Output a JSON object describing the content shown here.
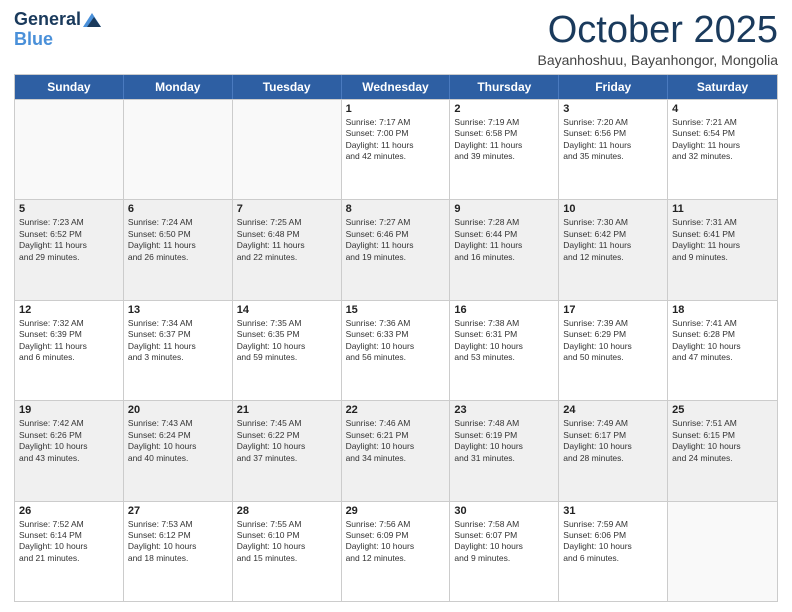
{
  "header": {
    "logo_general": "General",
    "logo_blue": "Blue",
    "month_title": "October 2025",
    "location": "Bayanhoshuu, Bayanhongor, Mongolia"
  },
  "days_of_week": [
    "Sunday",
    "Monday",
    "Tuesday",
    "Wednesday",
    "Thursday",
    "Friday",
    "Saturday"
  ],
  "rows": [
    [
      {
        "day": "",
        "lines": []
      },
      {
        "day": "",
        "lines": []
      },
      {
        "day": "",
        "lines": []
      },
      {
        "day": "1",
        "lines": [
          "Sunrise: 7:17 AM",
          "Sunset: 7:00 PM",
          "Daylight: 11 hours",
          "and 42 minutes."
        ]
      },
      {
        "day": "2",
        "lines": [
          "Sunrise: 7:19 AM",
          "Sunset: 6:58 PM",
          "Daylight: 11 hours",
          "and 39 minutes."
        ]
      },
      {
        "day": "3",
        "lines": [
          "Sunrise: 7:20 AM",
          "Sunset: 6:56 PM",
          "Daylight: 11 hours",
          "and 35 minutes."
        ]
      },
      {
        "day": "4",
        "lines": [
          "Sunrise: 7:21 AM",
          "Sunset: 6:54 PM",
          "Daylight: 11 hours",
          "and 32 minutes."
        ]
      }
    ],
    [
      {
        "day": "5",
        "lines": [
          "Sunrise: 7:23 AM",
          "Sunset: 6:52 PM",
          "Daylight: 11 hours",
          "and 29 minutes."
        ]
      },
      {
        "day": "6",
        "lines": [
          "Sunrise: 7:24 AM",
          "Sunset: 6:50 PM",
          "Daylight: 11 hours",
          "and 26 minutes."
        ]
      },
      {
        "day": "7",
        "lines": [
          "Sunrise: 7:25 AM",
          "Sunset: 6:48 PM",
          "Daylight: 11 hours",
          "and 22 minutes."
        ]
      },
      {
        "day": "8",
        "lines": [
          "Sunrise: 7:27 AM",
          "Sunset: 6:46 PM",
          "Daylight: 11 hours",
          "and 19 minutes."
        ]
      },
      {
        "day": "9",
        "lines": [
          "Sunrise: 7:28 AM",
          "Sunset: 6:44 PM",
          "Daylight: 11 hours",
          "and 16 minutes."
        ]
      },
      {
        "day": "10",
        "lines": [
          "Sunrise: 7:30 AM",
          "Sunset: 6:42 PM",
          "Daylight: 11 hours",
          "and 12 minutes."
        ]
      },
      {
        "day": "11",
        "lines": [
          "Sunrise: 7:31 AM",
          "Sunset: 6:41 PM",
          "Daylight: 11 hours",
          "and 9 minutes."
        ]
      }
    ],
    [
      {
        "day": "12",
        "lines": [
          "Sunrise: 7:32 AM",
          "Sunset: 6:39 PM",
          "Daylight: 11 hours",
          "and 6 minutes."
        ]
      },
      {
        "day": "13",
        "lines": [
          "Sunrise: 7:34 AM",
          "Sunset: 6:37 PM",
          "Daylight: 11 hours",
          "and 3 minutes."
        ]
      },
      {
        "day": "14",
        "lines": [
          "Sunrise: 7:35 AM",
          "Sunset: 6:35 PM",
          "Daylight: 10 hours",
          "and 59 minutes."
        ]
      },
      {
        "day": "15",
        "lines": [
          "Sunrise: 7:36 AM",
          "Sunset: 6:33 PM",
          "Daylight: 10 hours",
          "and 56 minutes."
        ]
      },
      {
        "day": "16",
        "lines": [
          "Sunrise: 7:38 AM",
          "Sunset: 6:31 PM",
          "Daylight: 10 hours",
          "and 53 minutes."
        ]
      },
      {
        "day": "17",
        "lines": [
          "Sunrise: 7:39 AM",
          "Sunset: 6:29 PM",
          "Daylight: 10 hours",
          "and 50 minutes."
        ]
      },
      {
        "day": "18",
        "lines": [
          "Sunrise: 7:41 AM",
          "Sunset: 6:28 PM",
          "Daylight: 10 hours",
          "and 47 minutes."
        ]
      }
    ],
    [
      {
        "day": "19",
        "lines": [
          "Sunrise: 7:42 AM",
          "Sunset: 6:26 PM",
          "Daylight: 10 hours",
          "and 43 minutes."
        ]
      },
      {
        "day": "20",
        "lines": [
          "Sunrise: 7:43 AM",
          "Sunset: 6:24 PM",
          "Daylight: 10 hours",
          "and 40 minutes."
        ]
      },
      {
        "day": "21",
        "lines": [
          "Sunrise: 7:45 AM",
          "Sunset: 6:22 PM",
          "Daylight: 10 hours",
          "and 37 minutes."
        ]
      },
      {
        "day": "22",
        "lines": [
          "Sunrise: 7:46 AM",
          "Sunset: 6:21 PM",
          "Daylight: 10 hours",
          "and 34 minutes."
        ]
      },
      {
        "day": "23",
        "lines": [
          "Sunrise: 7:48 AM",
          "Sunset: 6:19 PM",
          "Daylight: 10 hours",
          "and 31 minutes."
        ]
      },
      {
        "day": "24",
        "lines": [
          "Sunrise: 7:49 AM",
          "Sunset: 6:17 PM",
          "Daylight: 10 hours",
          "and 28 minutes."
        ]
      },
      {
        "day": "25",
        "lines": [
          "Sunrise: 7:51 AM",
          "Sunset: 6:15 PM",
          "Daylight: 10 hours",
          "and 24 minutes."
        ]
      }
    ],
    [
      {
        "day": "26",
        "lines": [
          "Sunrise: 7:52 AM",
          "Sunset: 6:14 PM",
          "Daylight: 10 hours",
          "and 21 minutes."
        ]
      },
      {
        "day": "27",
        "lines": [
          "Sunrise: 7:53 AM",
          "Sunset: 6:12 PM",
          "Daylight: 10 hours",
          "and 18 minutes."
        ]
      },
      {
        "day": "28",
        "lines": [
          "Sunrise: 7:55 AM",
          "Sunset: 6:10 PM",
          "Daylight: 10 hours",
          "and 15 minutes."
        ]
      },
      {
        "day": "29",
        "lines": [
          "Sunrise: 7:56 AM",
          "Sunset: 6:09 PM",
          "Daylight: 10 hours",
          "and 12 minutes."
        ]
      },
      {
        "day": "30",
        "lines": [
          "Sunrise: 7:58 AM",
          "Sunset: 6:07 PM",
          "Daylight: 10 hours",
          "and 9 minutes."
        ]
      },
      {
        "day": "31",
        "lines": [
          "Sunrise: 7:59 AM",
          "Sunset: 6:06 PM",
          "Daylight: 10 hours",
          "and 6 minutes."
        ]
      },
      {
        "day": "",
        "lines": []
      }
    ]
  ]
}
